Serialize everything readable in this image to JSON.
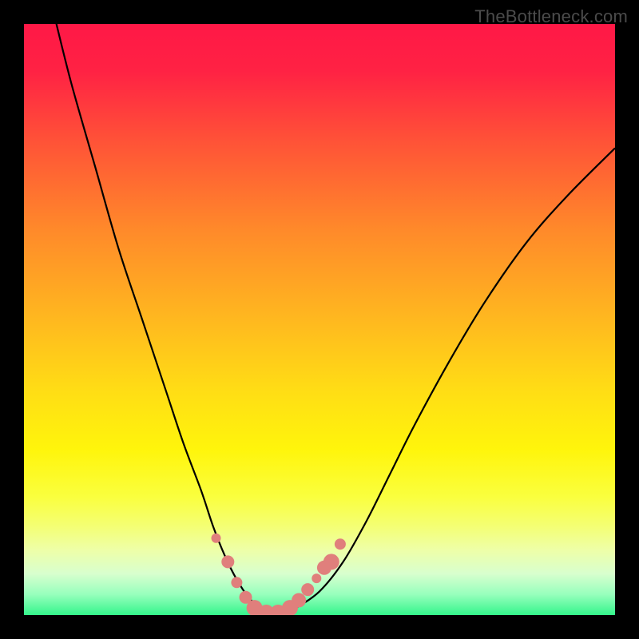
{
  "watermark": "TheBottleneck.com",
  "colors": {
    "background": "#000000",
    "watermark_text": "#4b4b4b",
    "curve_stroke": "#000000",
    "marker_fill": "#e07f7c",
    "marker_stroke": "#d06d6a",
    "gradient_stops": [
      {
        "offset": 0.0,
        "color": "#ff1846"
      },
      {
        "offset": 0.08,
        "color": "#ff2244"
      },
      {
        "offset": 0.2,
        "color": "#ff5337"
      },
      {
        "offset": 0.35,
        "color": "#ff8a2a"
      },
      {
        "offset": 0.5,
        "color": "#ffb81f"
      },
      {
        "offset": 0.62,
        "color": "#ffdd15"
      },
      {
        "offset": 0.72,
        "color": "#fff50b"
      },
      {
        "offset": 0.8,
        "color": "#faff3e"
      },
      {
        "offset": 0.85,
        "color": "#f4ff74"
      },
      {
        "offset": 0.89,
        "color": "#eeffa8"
      },
      {
        "offset": 0.93,
        "color": "#d8ffce"
      },
      {
        "offset": 0.965,
        "color": "#97ffbd"
      },
      {
        "offset": 1.0,
        "color": "#34f58b"
      }
    ]
  },
  "chart_data": {
    "type": "line",
    "title": "",
    "xlabel": "",
    "ylabel": "",
    "x_range": [
      0,
      100
    ],
    "y_range": [
      0,
      100
    ],
    "series": [
      {
        "name": "bottleneck-curve",
        "x": [
          5,
          8,
          12,
          16,
          20,
          24,
          27,
          30,
          32,
          34,
          36,
          38,
          40,
          42,
          44,
          46,
          50,
          54,
          58,
          62,
          66,
          72,
          78,
          85,
          92,
          100
        ],
        "y": [
          102,
          90,
          76,
          62,
          50,
          38,
          29,
          21,
          15,
          10,
          6,
          3,
          1.2,
          0.4,
          0.4,
          1.2,
          4,
          9,
          16,
          24,
          32,
          43,
          53,
          63,
          71,
          79
        ]
      }
    ],
    "markers": {
      "name": "highlight-points",
      "x": [
        32.5,
        34.5,
        36,
        37.5,
        39,
        41,
        43,
        45,
        46.5,
        48,
        49.5,
        50.8,
        52,
        53.5
      ],
      "y": [
        13,
        9,
        5.5,
        3,
        1.2,
        0.4,
        0.4,
        1.2,
        2.5,
        4.3,
        6.2,
        8,
        9,
        12
      ],
      "r": [
        6,
        8,
        7,
        8,
        10,
        10,
        10,
        10,
        9,
        8,
        6,
        9,
        10,
        7
      ]
    }
  }
}
